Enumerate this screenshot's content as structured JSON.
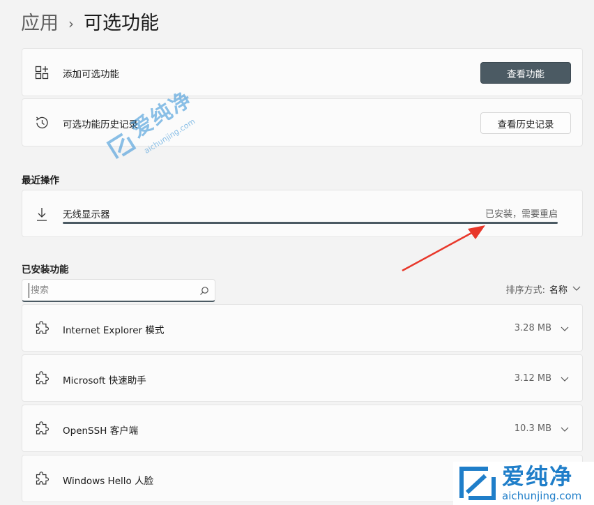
{
  "breadcrumb": {
    "parent": "应用",
    "separator": "›",
    "current": "可选功能"
  },
  "add_feature": {
    "label": "添加可选功能",
    "button": "查看功能",
    "icon": "add-grid-icon"
  },
  "history": {
    "label": "可选功能历史记录",
    "button": "查看历史记录",
    "icon": "history-icon"
  },
  "recent": {
    "title": "最近操作",
    "item": {
      "name": "无线显示器",
      "status": "已安装，需要重启",
      "progress": 1.0,
      "icon": "download-icon"
    }
  },
  "installed": {
    "title": "已安装功能",
    "search_placeholder": "搜索",
    "sort_label": "排序方式:",
    "sort_value": "名称",
    "items": [
      {
        "name": "Internet Explorer 模式",
        "size": "3.28 MB"
      },
      {
        "name": "Microsoft 快速助手",
        "size": "3.12 MB"
      },
      {
        "name": "OpenSSH 客户端",
        "size": "10.3 MB"
      },
      {
        "name": "Windows Hello 人脸",
        "size": ""
      }
    ]
  },
  "watermark": {
    "text": "爱纯净",
    "url": "aichunjing.com"
  },
  "colors": {
    "accent": "#4b5a63",
    "arrow": "#e8372a",
    "watermark": "#1f7ec9"
  }
}
